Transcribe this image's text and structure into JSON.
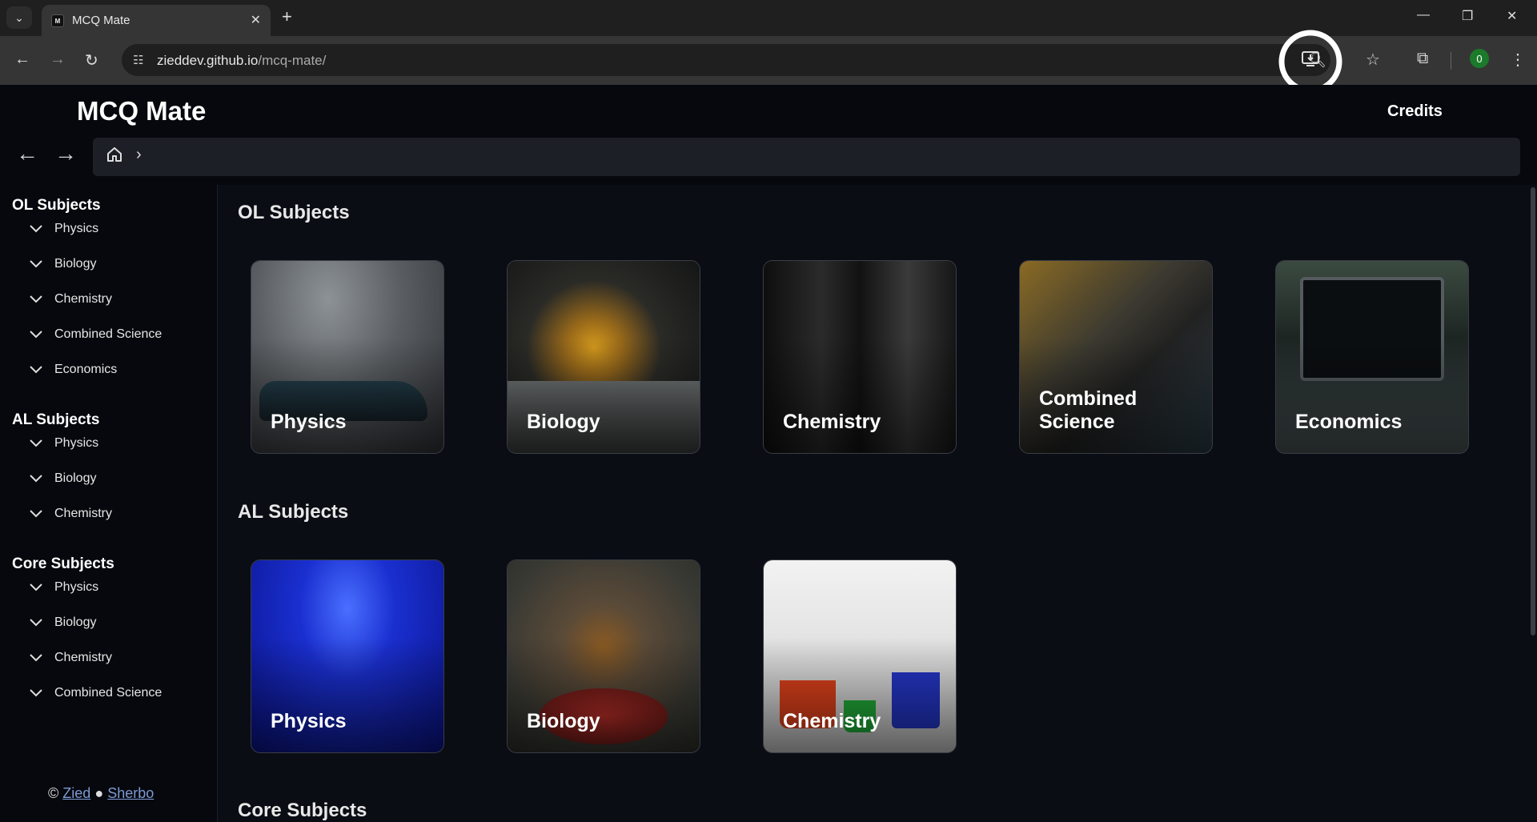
{
  "browser": {
    "tab_title": "MCQ Mate",
    "favicon_text": "M",
    "url_domain": "zieddev.github.io",
    "url_path": "/mcq-mate/",
    "profile_initial": "0"
  },
  "header": {
    "brand": "MCQ Mate",
    "credits": "Credits"
  },
  "sidebar": {
    "groups": [
      {
        "title": "OL Subjects",
        "items": [
          "Physics",
          "Biology",
          "Chemistry",
          "Combined Science",
          "Economics"
        ]
      },
      {
        "title": "AL Subjects",
        "items": [
          "Physics",
          "Biology",
          "Chemistry"
        ]
      },
      {
        "title": "Core Subjects",
        "items": [
          "Physics",
          "Biology",
          "Chemistry",
          "Combined Science"
        ]
      }
    ],
    "footer": {
      "copyright": "©",
      "author1": "Zied",
      "bullet": "●",
      "author2": "Sherbo"
    }
  },
  "content": {
    "sections": [
      {
        "title": "OL Subjects",
        "cards": [
          "Physics",
          "Biology",
          "Chemistry",
          "Combined Science",
          "Economics"
        ]
      },
      {
        "title": "AL Subjects",
        "cards": [
          "Physics",
          "Biology",
          "Chemistry"
        ]
      },
      {
        "title": "Core Subjects"
      }
    ]
  }
}
